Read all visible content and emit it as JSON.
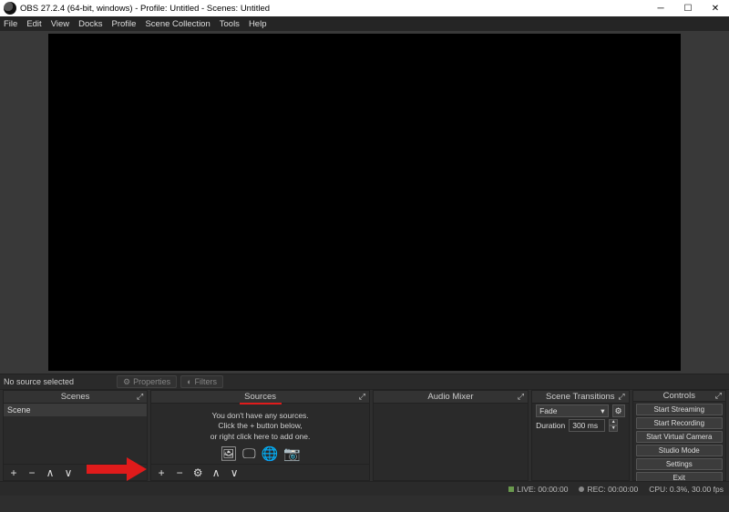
{
  "titlebar": {
    "title": "OBS 27.2.4 (64-bit, windows) - Profile: Untitled - Scenes: Untitled"
  },
  "menu": [
    "File",
    "Edit",
    "View",
    "Docks",
    "Profile",
    "Scene Collection",
    "Tools",
    "Help"
  ],
  "toolbar": {
    "no_source": "No source selected",
    "properties": "Properties",
    "filters": "Filters"
  },
  "panels": {
    "scenes": {
      "title": "Scenes",
      "items": [
        "Scene"
      ]
    },
    "sources": {
      "title": "Sources",
      "empty1": "You don't have any sources.",
      "empty2": "Click the + button below,",
      "empty3": "or right click here to add one."
    },
    "mixer": {
      "title": "Audio Mixer"
    },
    "transitions": {
      "title": "Scene Transitions",
      "selected": "Fade",
      "duration_label": "Duration",
      "duration_value": "300 ms"
    },
    "controls": {
      "title": "Controls",
      "buttons": [
        "Start Streaming",
        "Start Recording",
        "Start Virtual Camera",
        "Studio Mode",
        "Settings",
        "Exit"
      ]
    }
  },
  "status": {
    "live": "LIVE: 00:00:00",
    "rec": "REC: 00:00:00",
    "cpu": "CPU: 0.3%, 30.00 fps"
  }
}
